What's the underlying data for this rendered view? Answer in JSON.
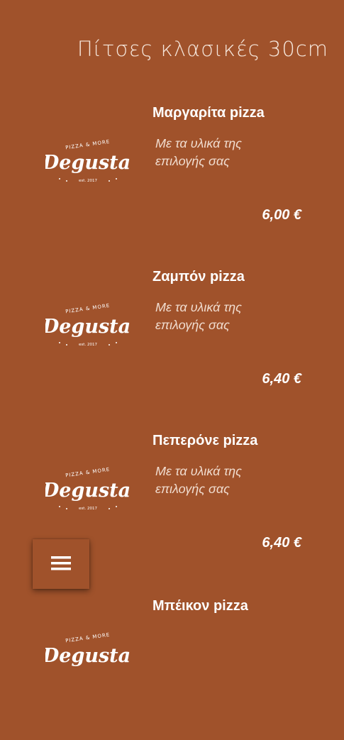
{
  "page": {
    "title": "Πίτσες κλασικές 30cm"
  },
  "logo": {
    "brand": "Degusta",
    "tagline": "PIZZA & MORE",
    "established": "est. 2017"
  },
  "menu_items": [
    {
      "name": "Μαργαρίτα pizza",
      "description": "Με τα υλικά της επιλογής σας",
      "price": "6,00 €"
    },
    {
      "name": "Ζαμπόν pizza",
      "description": "Με τα υλικά της επιλογής σας",
      "price": "6,40 €"
    },
    {
      "name": "Πεπερόνε pizza",
      "description": "Με τα υλικά της επιλογής σας",
      "price": "6,40 €"
    },
    {
      "name": "Μπέικον pizza",
      "description": "",
      "price": ""
    }
  ],
  "nav": {
    "toggle_icon": "hamburger-menu-icon"
  },
  "colors": {
    "background": "#a0522b",
    "text": "#ffffff"
  }
}
